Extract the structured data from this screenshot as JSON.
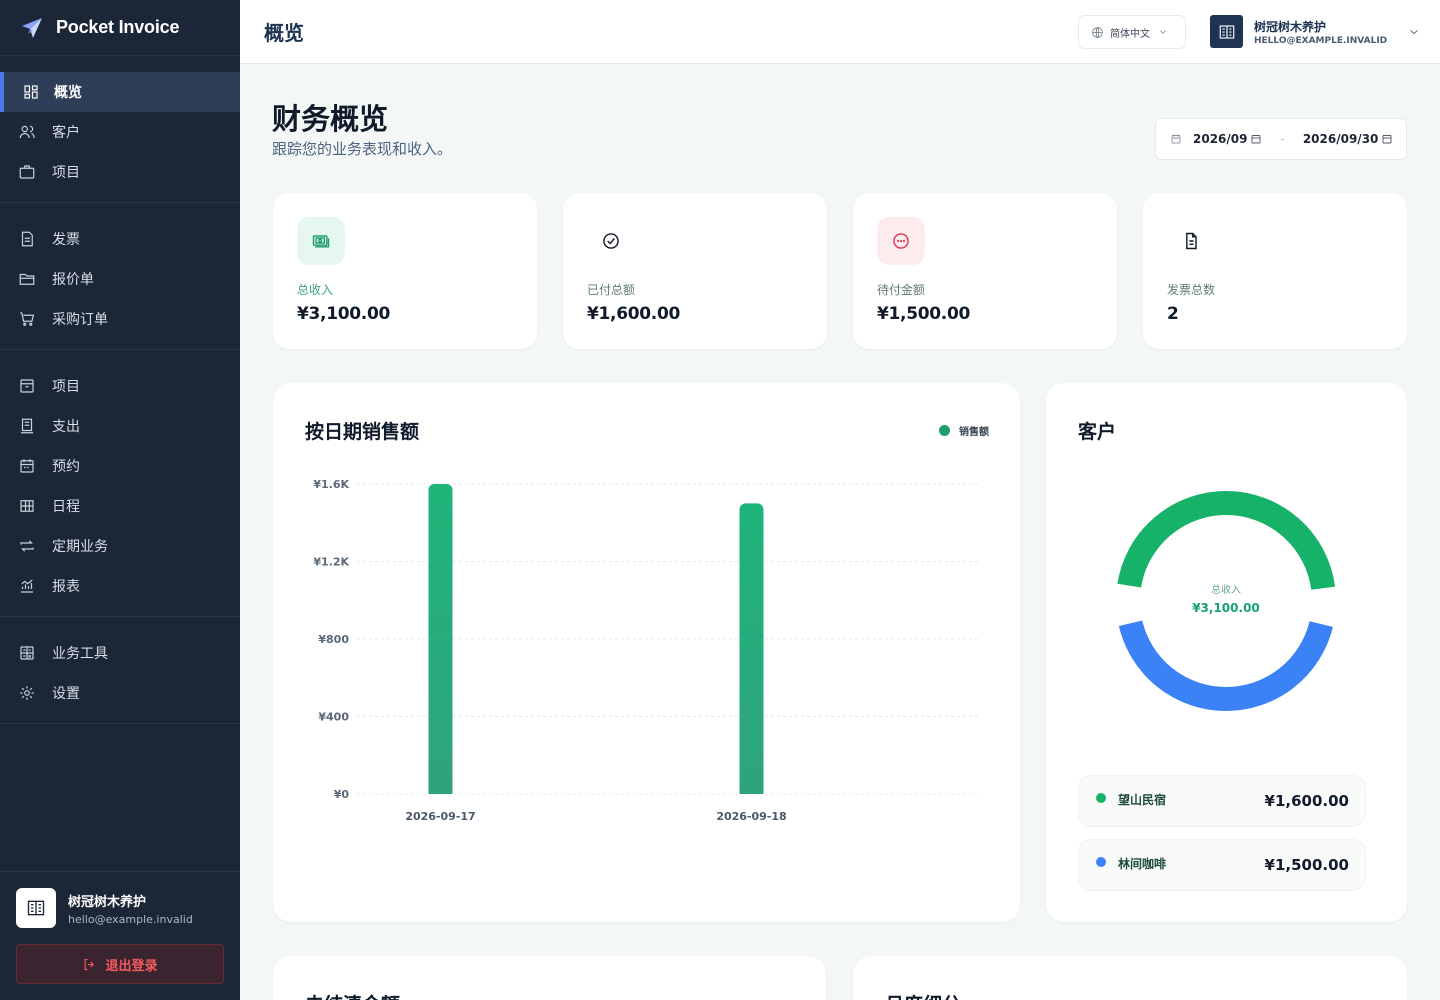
{
  "brand": {
    "name": "Pocket Invoice"
  },
  "sidebar": {
    "groups": [
      [
        {
          "label": "概览",
          "icon": "dashboard-icon",
          "active": true
        },
        {
          "label": "客户",
          "icon": "users-icon"
        },
        {
          "label": "项目",
          "icon": "briefcase-icon"
        }
      ],
      [
        {
          "label": "发票",
          "icon": "invoice-icon"
        },
        {
          "label": "报价单",
          "icon": "quote-icon"
        },
        {
          "label": "采购订单",
          "icon": "cart-icon"
        }
      ],
      [
        {
          "label": "项目",
          "icon": "archive-icon"
        },
        {
          "label": "支出",
          "icon": "receipt-icon"
        },
        {
          "label": "预约",
          "icon": "calendar-icon"
        },
        {
          "label": "日程",
          "icon": "grid-icon"
        },
        {
          "label": "定期业务",
          "icon": "repeat-icon"
        },
        {
          "label": "报表",
          "icon": "chart-icon"
        }
      ],
      [
        {
          "label": "业务工具",
          "icon": "calculator-icon"
        },
        {
          "label": "设置",
          "icon": "gear-icon"
        }
      ]
    ],
    "user": {
      "name": "树冠树木养护",
      "email": "hello@example.invalid"
    },
    "logout_label": "退出登录"
  },
  "header": {
    "title": "概览",
    "language": "简体中文",
    "account_name": "树冠树木养护",
    "account_email": "HELLO@EXAMPLE.INVALID"
  },
  "main": {
    "title": "财务概览",
    "subtitle": "跟踪您的业务表现和收入。",
    "date_start": "2026/09",
    "date_end": "2026/09/30",
    "date_sep": "-"
  },
  "stats": [
    {
      "label": "总收入",
      "value": "¥3,100.00",
      "icon": "cash-icon",
      "bg": "#e6f7ef",
      "color": "#1f9d6b"
    },
    {
      "label": "已付总额",
      "value": "¥1,600.00",
      "icon": "check-circle-icon",
      "bg": "#ffffff",
      "color": "#111827"
    },
    {
      "label": "待付金额",
      "value": "¥1,500.00",
      "icon": "pending-icon",
      "bg": "#fdecee",
      "color": "#e0344f"
    },
    {
      "label": "发票总数",
      "value": "2",
      "icon": "document-icon",
      "bg": "#ffffff",
      "color": "#111827"
    }
  ],
  "sales_card": {
    "title": "按日期销售额",
    "legend": "销售额"
  },
  "chart_data": {
    "type": "bar",
    "categories": [
      "2026-09-17",
      "2026-09-18"
    ],
    "series": [
      {
        "name": "销售额",
        "values": [
          1600,
          1500
        ]
      }
    ],
    "yticks": [
      "¥0",
      "¥400",
      "¥800",
      "¥1.2K",
      "¥1.6K"
    ],
    "ylim": [
      0,
      1600
    ],
    "bar_color": "#1fb47a",
    "grid": true,
    "legend_position": "top-right"
  },
  "customers_card": {
    "title": "客户",
    "center_label": "总收入",
    "center_value": "¥3,100.00",
    "items": [
      {
        "name": "望山民宿",
        "amount": "¥1,600.00",
        "value": 1600,
        "color": "#17b26a"
      },
      {
        "name": "林间咖啡",
        "amount": "¥1,500.00",
        "value": 1500,
        "color": "#3b82f6"
      }
    ]
  },
  "bottom_cards": [
    "未结清金额",
    "月度细分"
  ]
}
